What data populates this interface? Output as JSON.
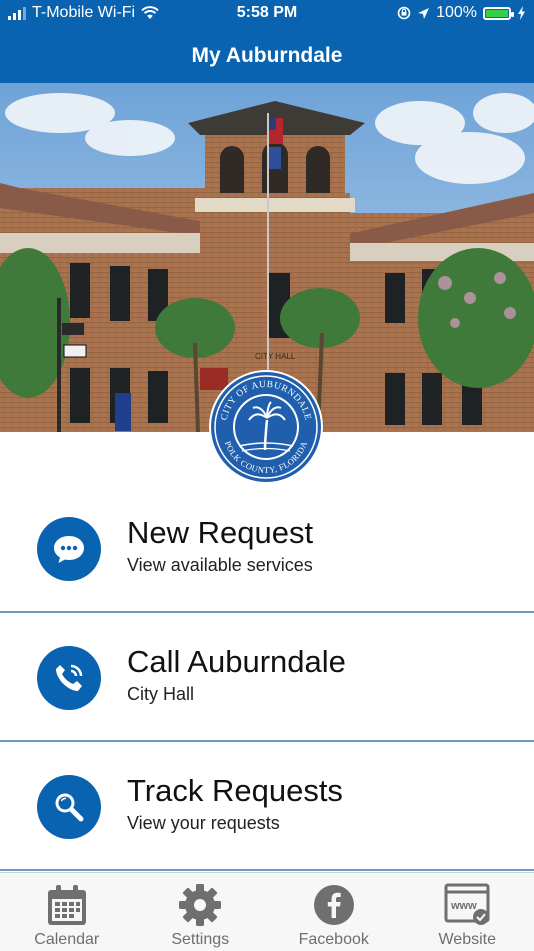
{
  "status_bar": {
    "carrier": "T-Mobile Wi-Fi",
    "time": "5:58 PM",
    "battery_percent": "100%",
    "battery_level": 1.0
  },
  "header": {
    "title": "My Auburndale"
  },
  "hero": {
    "sign_text": "CITY HALL",
    "seal": {
      "top_text": "CITY OF AUBURNDALE",
      "bottom_text": "POLK COUNTY, FLORIDA"
    }
  },
  "menu": [
    {
      "title": "New Request",
      "subtitle": "View available services",
      "icon": "chat-bubble-icon"
    },
    {
      "title": "Call Auburndale",
      "subtitle": "City Hall",
      "icon": "phone-icon"
    },
    {
      "title": "Track Requests",
      "subtitle": "View your requests",
      "icon": "magnifier-icon"
    }
  ],
  "tabs": [
    {
      "label": "Calendar",
      "icon": "calendar-icon"
    },
    {
      "label": "Settings",
      "icon": "gear-icon"
    },
    {
      "label": "Facebook",
      "icon": "facebook-icon"
    },
    {
      "label": "Website",
      "icon": "www-icon"
    }
  ],
  "colors": {
    "primary": "#0a63b0",
    "divider": "#6d9ac7",
    "tab_icon": "#6f6f6f",
    "battery": "#35d04a"
  }
}
